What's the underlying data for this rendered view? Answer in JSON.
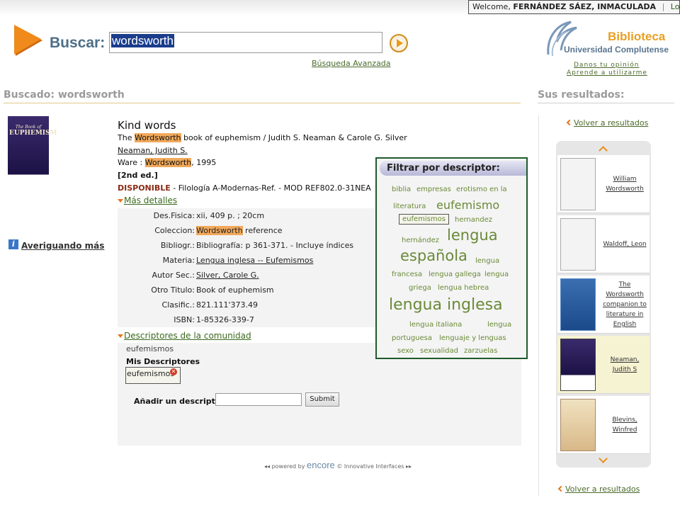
{
  "header": {
    "welcome_prefix": "Welcome,",
    "user_name": "FERNÁNDEZ SÁEZ, INMACULADA",
    "separator": "|",
    "logout": "Logout"
  },
  "search": {
    "label": "Buscar:",
    "query": "wordsworth",
    "advanced": "Búsqueda Avanzada"
  },
  "library": {
    "name": "Biblioteca",
    "subtitle": "Universidad Complutense",
    "opinion": "Danos tu opinión",
    "learn": "Aprende a utilizarme"
  },
  "searched": {
    "label": "Buscado: wordsworth"
  },
  "results_heading": "Sus resultados:",
  "cover": {
    "title": "The Book of",
    "title2": "EUPHEMISM"
  },
  "aver": "Averiguando más",
  "record": {
    "title": "Kind words",
    "line1_pre": "The ",
    "line1_hl": "Wordsworth",
    "line1_post": " book of euphemism / Judith S. Neaman & Carole G. Silver",
    "author": "Neaman, Judith S.",
    "pub_pre": "Ware : ",
    "pub_hl": "Wordsworth",
    "pub_post": ", 1995",
    "edition": "[2nd ed.]",
    "status": "DISPONIBLE",
    "location": " - Filología A-Modernas-Ref. - MOD REF802.0-31NEA",
    "more": "Más detalles",
    "details": [
      {
        "label": "Des.Fisica:",
        "value": "xii, 409 p. ; 20cm"
      },
      {
        "label": "Coleccion:",
        "value_hl": "Wordsworth",
        "value": " reference"
      },
      {
        "label": "Bibliogr.:",
        "value": "Bibliografía: p 361-371. - Incluye índices"
      },
      {
        "label": "Materia:",
        "value": "Lengua inglesa -- Eufemismos"
      },
      {
        "label": "Autor Sec.:",
        "value": "Silver, Carole G."
      },
      {
        "label": "Otro Titulo:",
        "value": "Book of euphemism"
      },
      {
        "label": "Clasific.:",
        "value": "821.111'373.49"
      },
      {
        "label": "ISBN:",
        "value": "1-85326-339-7"
      }
    ],
    "community_heading": "Descriptores de la comunidad",
    "community_tag": "eufemismos",
    "my_heading": "Mis Descriptores",
    "my_tag": "eufemismos",
    "add_label": "Añadir un descriptor",
    "submit": "Submit"
  },
  "filter": {
    "heading": "Filtrar por descriptor:",
    "tags": [
      "biblia",
      "empresas",
      "erotismo en la",
      "literatura",
      "eufemismo",
      "eufemismos",
      "hernandez",
      "hernández",
      "lengua",
      "española",
      "lengua",
      "francesa",
      "lengua gallega",
      "lengua",
      "griega",
      "lengua hebrea",
      "lengua inglesa",
      "lengua italiana",
      "lengua",
      "portuguesa",
      "lenguaje y lenguas",
      "sexo",
      "sexualidad",
      "zarzuelas"
    ]
  },
  "footer": {
    "powered": "◂◂ powered by",
    "brand": "encore",
    "vendor": "© Innovative Interfaces ▸▸"
  },
  "sidebar": {
    "back_top": "Volver a resultados",
    "back_bottom": "Volver a resultados",
    "items": [
      {
        "label": "William Wordsworth"
      },
      {
        "label": "Waldoff, Leon"
      },
      {
        "label": "The Wordsworth companion to literature in English"
      },
      {
        "label": "Neaman, Judith S"
      },
      {
        "label": "Blevins, Winfred"
      }
    ]
  },
  "colors": {
    "accent_green": "#2b5a1f",
    "highlight": "#f0a85a",
    "filter_border": "#1f5a2c",
    "link_green": "#4a6a2a",
    "library_orange": "#e8a020"
  }
}
